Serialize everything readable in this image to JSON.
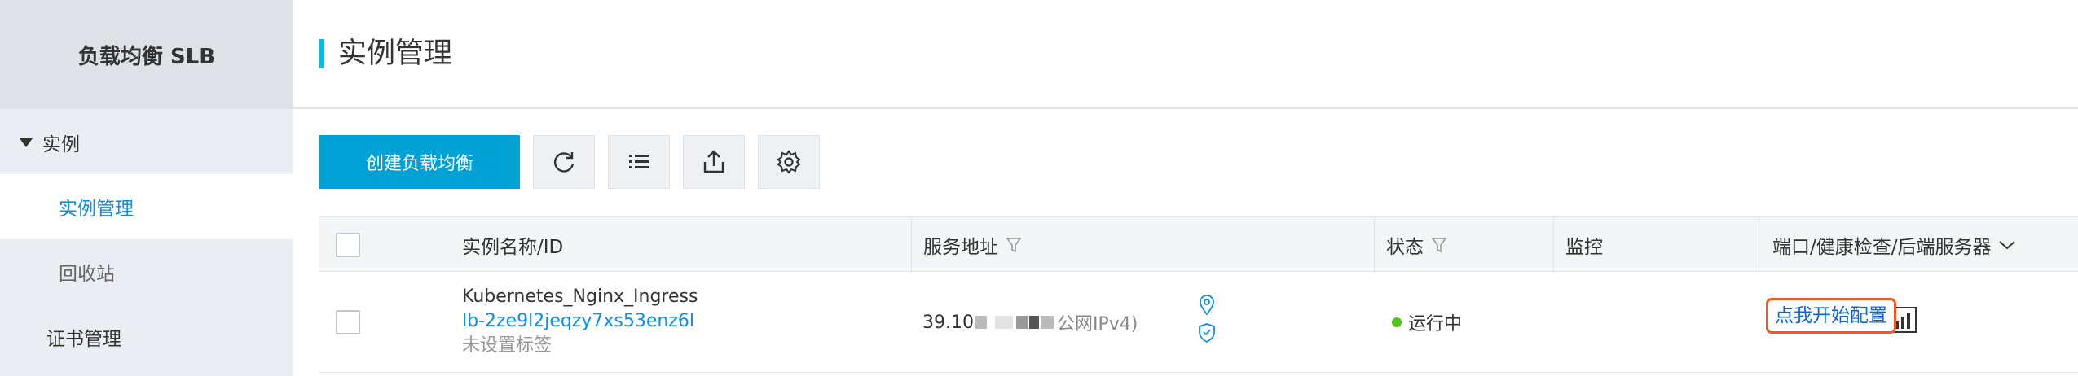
{
  "sidebar": {
    "title": "负载均衡 SLB",
    "group_label": "实例",
    "items": [
      {
        "label": "实例管理"
      },
      {
        "label": "回收站"
      },
      {
        "label": "证书管理"
      }
    ]
  },
  "header": {
    "title": "实例管理"
  },
  "toolbar": {
    "create_label": "创建负载均衡",
    "icons": [
      "refresh-icon",
      "list-icon",
      "export-icon",
      "settings-icon"
    ]
  },
  "table": {
    "columns": [
      "实例名称/ID",
      "服务地址",
      "状态",
      "监控",
      "端口/健康检查/后端服务器"
    ],
    "rows": [
      {
        "name": "Kubernetes_Nginx_Ingress",
        "id": "lb-2ze9l2jeqzy7xs53enz6l",
        "tag": "未设置标签",
        "address_prefix": "39.10",
        "address_type": "公网IPv4)",
        "status": "运行中",
        "config_link": "点我开始配置"
      }
    ]
  },
  "colors": {
    "primary": "#00a2d6",
    "link": "#0b8ee8",
    "status_ok": "#52c41a",
    "highlight": "#f05a24"
  }
}
